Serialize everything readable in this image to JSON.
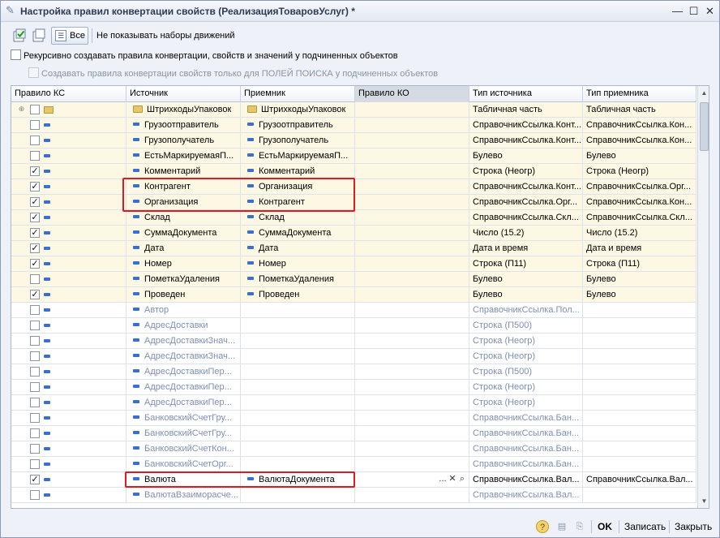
{
  "window": {
    "title": "Настройка правил конвертации свойств (РеализацияТоваровУслуг) *",
    "icon": "pencil-icon",
    "controls": [
      "minimize-icon",
      "maximize-icon",
      "close-icon"
    ]
  },
  "toolbar": {
    "all_label": "Все",
    "hide_sets_label": "Не показывать наборы движений"
  },
  "options": {
    "recursive_label": "Рекурсивно создавать правила конвертации, свойств и значений у подчиненных объектов",
    "search_only_label": "Создавать правила конвертации свойств только для ПОЛЕЙ ПОИСКА у подчиненных объектов"
  },
  "grid": {
    "columns": [
      "Правило КС",
      "Источник",
      "Приемник",
      "Правило КО",
      "Тип источника",
      "Тип приемника"
    ],
    "rows": [
      {
        "group": true,
        "checked": false,
        "style": "yellow",
        "src": "ШтрихкодыУпаковок",
        "dst": "ШтрихкодыУпаковок",
        "rule_ko": "",
        "src_type": "Табличная часть",
        "dst_type": "Табличная часть"
      },
      {
        "checked": false,
        "style": "yellow",
        "src": "Грузоотправитель",
        "dst": "Грузоотправитель",
        "rule_ko": "",
        "src_type": "СправочникСсылка.Конт...",
        "dst_type": "СправочникСсылка.Кон..."
      },
      {
        "checked": false,
        "style": "yellow",
        "src": "Грузополучатель",
        "dst": "Грузополучатель",
        "rule_ko": "",
        "src_type": "СправочникСсылка.Конт...",
        "dst_type": "СправочникСсылка.Кон..."
      },
      {
        "checked": false,
        "style": "yellow",
        "src": "ЕстьМаркируемаяП...",
        "dst": "ЕстьМаркируемаяП...",
        "rule_ko": "",
        "src_type": "Булево",
        "dst_type": "Булево"
      },
      {
        "checked": true,
        "style": "yellow",
        "src": "Комментарий",
        "dst": "Комментарий",
        "rule_ko": "",
        "src_type": "Строка (Неогр)",
        "dst_type": "Строка (Неогр)"
      },
      {
        "checked": true,
        "style": "yellow",
        "src": "Контрагент",
        "dst": "Организация",
        "rule_ko": "",
        "src_type": "СправочникСсылка.Конт...",
        "dst_type": "СправочникСсылка.Орг..."
      },
      {
        "checked": true,
        "style": "yellow",
        "src": "Организация",
        "dst": "Контрагент",
        "rule_ko": "",
        "src_type": "СправочникСсылка.Орг...",
        "dst_type": "СправочникСсылка.Кон..."
      },
      {
        "checked": true,
        "style": "yellow",
        "src": "Склад",
        "dst": "Склад",
        "rule_ko": "",
        "src_type": "СправочникСсылка.Скл...",
        "dst_type": "СправочникСсылка.Скл..."
      },
      {
        "checked": true,
        "style": "yellow",
        "src": "СуммаДокумента",
        "dst": "СуммаДокумента",
        "rule_ko": "",
        "src_type": "Число (15.2)",
        "dst_type": "Число (15.2)"
      },
      {
        "checked": true,
        "style": "yellow",
        "src": "Дата",
        "dst": "Дата",
        "rule_ko": "",
        "src_type": "Дата и время",
        "dst_type": "Дата и время"
      },
      {
        "checked": true,
        "style": "yellow",
        "src": "Номер",
        "dst": "Номер",
        "rule_ko": "",
        "src_type": "Строка (П11)",
        "dst_type": "Строка (П11)"
      },
      {
        "checked": false,
        "style": "yellow",
        "src": "ПометкаУдаления",
        "dst": "ПометкаУдаления",
        "rule_ko": "",
        "src_type": "Булево",
        "dst_type": "Булево"
      },
      {
        "checked": true,
        "style": "yellow",
        "src": "Проведен",
        "dst": "Проведен",
        "rule_ko": "",
        "src_type": "Булево",
        "dst_type": "Булево"
      },
      {
        "checked": false,
        "style": "grey",
        "src": "Автор",
        "dst": "",
        "rule_ko": "",
        "src_type": "СправочникСсылка.Пол...",
        "dst_type": ""
      },
      {
        "checked": false,
        "style": "grey",
        "src": "АдресДоставки",
        "dst": "",
        "rule_ko": "",
        "src_type": "Строка (П500)",
        "dst_type": ""
      },
      {
        "checked": false,
        "style": "grey",
        "src": "АдресДоставкиЗнач...",
        "dst": "",
        "rule_ko": "",
        "src_type": "Строка (Неогр)",
        "dst_type": ""
      },
      {
        "checked": false,
        "style": "grey",
        "src": "АдресДоставкиЗнач...",
        "dst": "",
        "rule_ko": "",
        "src_type": "Строка (Неогр)",
        "dst_type": ""
      },
      {
        "checked": false,
        "style": "grey",
        "src": "АдресДоставкиПер...",
        "dst": "",
        "rule_ko": "",
        "src_type": "Строка (П500)",
        "dst_type": ""
      },
      {
        "checked": false,
        "style": "grey",
        "src": "АдресДоставкиПер...",
        "dst": "",
        "rule_ko": "",
        "src_type": "Строка (Неогр)",
        "dst_type": ""
      },
      {
        "checked": false,
        "style": "grey",
        "src": "АдресДоставкиПер...",
        "dst": "",
        "rule_ko": "",
        "src_type": "Строка (Неогр)",
        "dst_type": ""
      },
      {
        "checked": false,
        "style": "grey",
        "src": "БанковскийСчетГру...",
        "dst": "",
        "rule_ko": "",
        "src_type": "СправочникСсылка.Бан...",
        "dst_type": ""
      },
      {
        "checked": false,
        "style": "grey",
        "src": "БанковскийСчетГру...",
        "dst": "",
        "rule_ko": "",
        "src_type": "СправочникСсылка.Бан...",
        "dst_type": ""
      },
      {
        "checked": false,
        "style": "grey",
        "src": "БанковскийСчетКон...",
        "dst": "",
        "rule_ko": "",
        "src_type": "СправочникСсылка.Бан...",
        "dst_type": ""
      },
      {
        "checked": false,
        "style": "grey",
        "src": "БанковскийСчетОрг...",
        "dst": "",
        "rule_ko": "",
        "src_type": "СправочникСсылка.Бан...",
        "dst_type": ""
      },
      {
        "checked": true,
        "style": "white",
        "src": "Валюта",
        "dst": "ВалютаДокумента",
        "rule_ko": "...",
        "src_type": "СправочникСсылка.Вал...",
        "dst_type": "СправочникСсылка.Вал...",
        "editing": true
      },
      {
        "checked": false,
        "style": "grey",
        "src": "ВалютаВзаиморасче...",
        "dst": "",
        "rule_ko": "",
        "src_type": "СправочникСсылка.Вал...",
        "dst_type": ""
      }
    ]
  },
  "statusbar": {
    "ok_label": "OK",
    "save_label": "Записать",
    "close_label": "Закрыть"
  },
  "colors": {
    "highlight": "#e0191f",
    "row_yellow": "#fdf8e3",
    "grey_text": "#7e8fb5"
  }
}
